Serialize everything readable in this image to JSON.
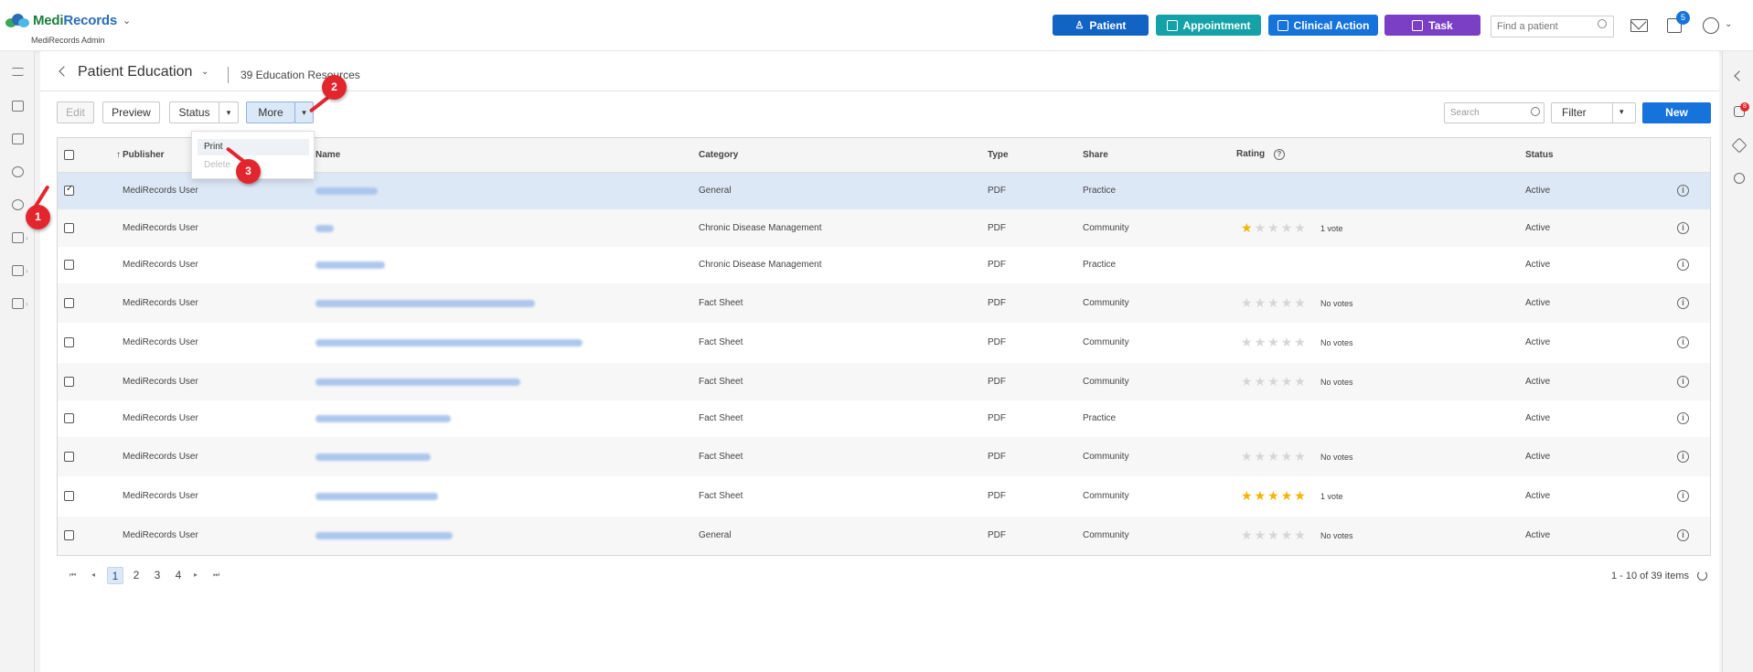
{
  "app": {
    "brand_part1": "Medi",
    "brand_part2": "Records",
    "subtitle": "MediRecords Admin"
  },
  "top_actions": [
    {
      "label": "Patient",
      "color": "#1163c4"
    },
    {
      "label": "Appointment",
      "color": "#14a2a8"
    },
    {
      "label": "Clinical Action",
      "color": "#1773dc"
    },
    {
      "label": "Task",
      "color": "#7b3fc6"
    }
  ],
  "find_patient": {
    "placeholder": "Find a patient"
  },
  "tasks_badge": "5",
  "notifications_badge": "8",
  "page": {
    "title": "Patient Education",
    "resource_count": "39 Education Resources"
  },
  "toolbar": {
    "edit": "Edit",
    "preview": "Preview",
    "status": "Status",
    "more": "More",
    "search_placeholder": "Search",
    "filter": "Filter",
    "new": "New"
  },
  "more_menu": {
    "print": "Print",
    "delete": "Delete"
  },
  "table": {
    "columns": {
      "publisher": "Publisher",
      "name": "Name",
      "category": "Category",
      "type": "Type",
      "share": "Share",
      "rating": "Rating",
      "status": "Status"
    },
    "rows": [
      {
        "publisher": "MediRecords User",
        "category": "General",
        "type": "PDF",
        "share": "Practice",
        "stars": 0,
        "votes": "",
        "status": "Active",
        "checked": true
      },
      {
        "publisher": "MediRecords User",
        "category": "Chronic Disease Management",
        "type": "PDF",
        "share": "Community",
        "stars": 1,
        "votes": "1 vote",
        "status": "Active",
        "checked": false
      },
      {
        "publisher": "MediRecords User",
        "category": "Chronic Disease Management",
        "type": "PDF",
        "share": "Practice",
        "stars": 0,
        "votes": "",
        "status": "Active",
        "checked": false
      },
      {
        "publisher": "MediRecords User",
        "category": "Fact Sheet",
        "type": "PDF",
        "share": "Community",
        "stars": 0,
        "votes": "No votes",
        "status": "Active",
        "checked": false
      },
      {
        "publisher": "MediRecords User",
        "category": "Fact Sheet",
        "type": "PDF",
        "share": "Community",
        "stars": 0,
        "votes": "No votes",
        "status": "Active",
        "checked": false
      },
      {
        "publisher": "MediRecords User",
        "category": "Fact Sheet",
        "type": "PDF",
        "share": "Community",
        "stars": 0,
        "votes": "No votes",
        "status": "Active",
        "checked": false
      },
      {
        "publisher": "MediRecords User",
        "category": "Fact Sheet",
        "type": "PDF",
        "share": "Practice",
        "stars": 0,
        "votes": "",
        "status": "Active",
        "checked": false
      },
      {
        "publisher": "MediRecords User",
        "category": "Fact Sheet",
        "type": "PDF",
        "share": "Community",
        "stars": 0,
        "votes": "No votes",
        "status": "Active",
        "checked": false
      },
      {
        "publisher": "MediRecords User",
        "category": "Fact Sheet",
        "type": "PDF",
        "share": "Community",
        "stars": 5,
        "votes": "1 vote",
        "status": "Active",
        "checked": false
      },
      {
        "publisher": "MediRecords User",
        "category": "General",
        "type": "PDF",
        "share": "Community",
        "stars": 0,
        "votes": "No votes",
        "status": "Active",
        "checked": false
      }
    ]
  },
  "pager": {
    "pages": [
      "1",
      "2",
      "3",
      "4"
    ],
    "current": "1",
    "info": "1 - 10 of 39 items"
  },
  "callouts": [
    "1",
    "2",
    "3"
  ]
}
